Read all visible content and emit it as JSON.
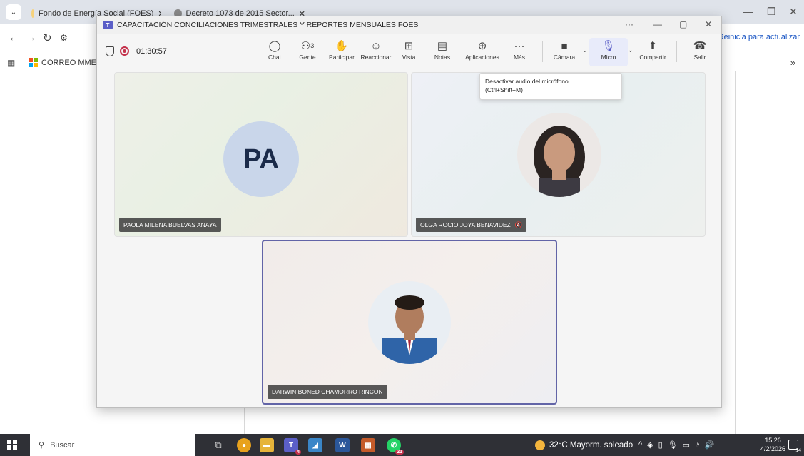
{
  "browser": {
    "tabs": [
      {
        "label": "Fondo de Energía Social (FOES)"
      },
      {
        "label": "Decreto 1073 de 2015 Sector..."
      }
    ],
    "update_label": "Reinicia para actualizar",
    "bookmarks": [
      {
        "label": "CORREO MME"
      }
    ],
    "more_label": "»"
  },
  "teams": {
    "window_title": "CAPACITACIÓN CONCILIACIONES TRIMESTRALES Y REPORTES MENSUALES FOES",
    "timer": "01:30:57",
    "people_count": "3",
    "toolbar": {
      "chat": "Chat",
      "people": "Gente",
      "raise": "Participar",
      "react": "Reaccionar",
      "view": "Vista",
      "notes": "Notas",
      "apps": "Aplicaciones",
      "more": "Más",
      "camera": "Cámara",
      "mic": "Micro",
      "share": "Compartir",
      "leave": "Salir"
    },
    "tooltip_line1": "Desactivar audio del micrófono",
    "tooltip_line2": "(Ctrl+Shift+M)",
    "participants": [
      {
        "name": "PAOLA MILENA BUELVAS ANAYA",
        "initials": "PA"
      },
      {
        "name": "OLGA ROCIO JOYA BENAVIDEZ",
        "muted": true
      },
      {
        "name": "DARWIN BONED CHAMORRO RINCON",
        "speaking": true
      }
    ]
  },
  "taskbar": {
    "search_placeholder": "Buscar",
    "teams_badge": "4",
    "whatsapp_badge": "21",
    "weather": "32°C  Mayorm. soleado",
    "time": "15:26",
    "date": "4/2/2026",
    "notif_count": "14"
  }
}
